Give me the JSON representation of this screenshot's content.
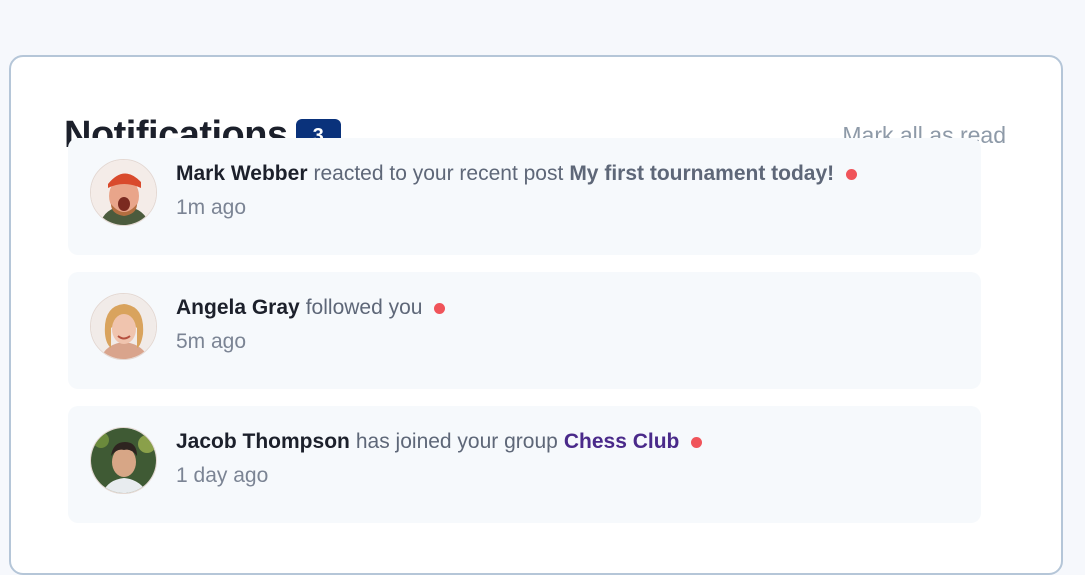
{
  "header": {
    "title": "Notifications",
    "unread_count": "3",
    "mark_all_label": "Mark all as read"
  },
  "notifications": [
    {
      "name": "Mark Webber",
      "action": "reacted to your recent post",
      "target": "My first tournament today!",
      "time": "1m ago",
      "unread": true
    },
    {
      "name": "Angela Gray",
      "action": "followed you",
      "time": "5m ago",
      "unread": true
    },
    {
      "name": "Jacob Thompson",
      "action": "has joined your group",
      "target": "Chess Club",
      "time": "1 day ago",
      "unread": true
    }
  ],
  "colors": {
    "badge": "#0a327b",
    "unread_dot": "#f0545a",
    "group_link": "#4a2a8a",
    "card_border": "#b5c6d8"
  }
}
